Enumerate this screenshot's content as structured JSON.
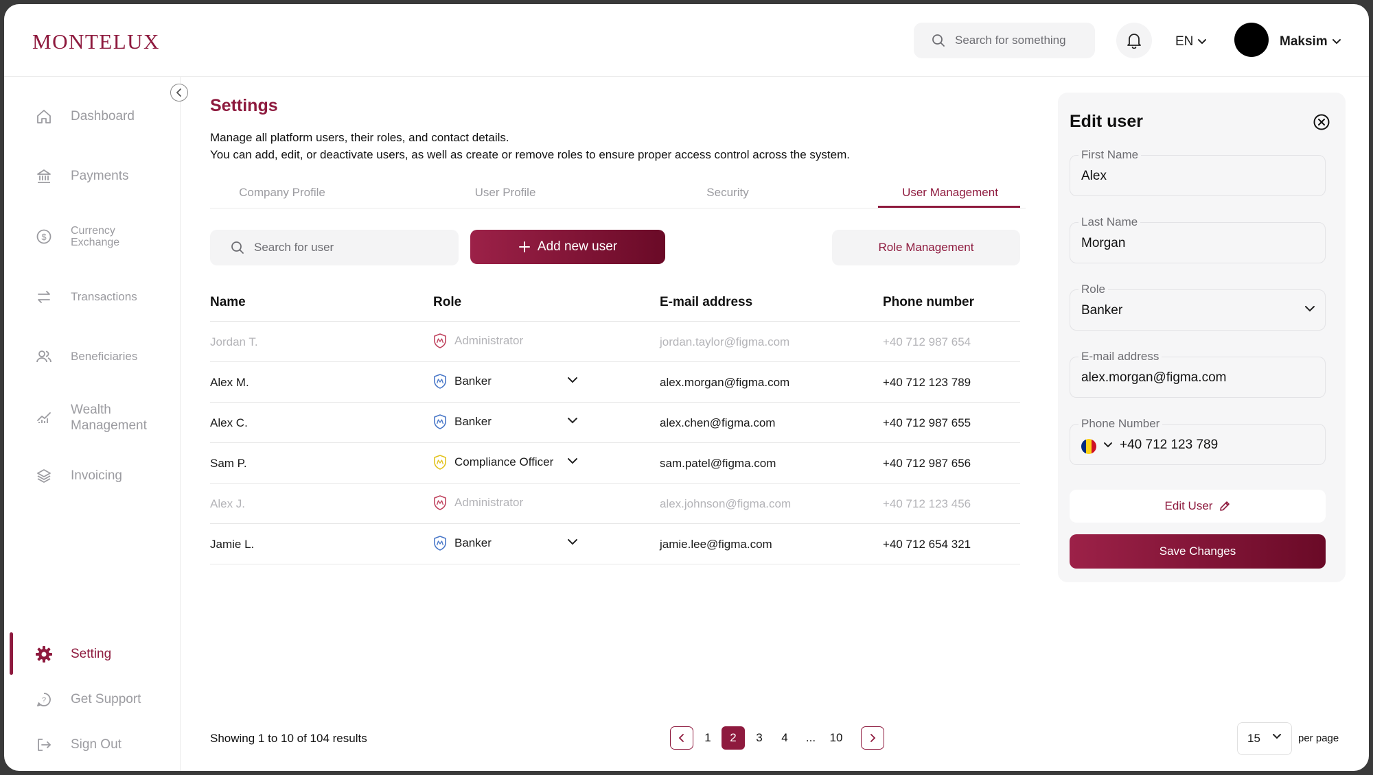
{
  "brand": {
    "logo": "MONTELUX",
    "accent": "#8e1a3e"
  },
  "topbar": {
    "search_placeholder": "Search for something",
    "language": "EN",
    "user_name": "Maksim"
  },
  "sidebar": {
    "items": [
      {
        "label": "Dashboard",
        "icon": "home-icon"
      },
      {
        "label": "Payments",
        "icon": "bank-icon"
      },
      {
        "label": "Currency Exchange",
        "line1": "Currency",
        "line2": "Exchange",
        "icon": "dollar-circle-icon"
      },
      {
        "label": "Transactions",
        "icon": "arrows-swap-icon"
      },
      {
        "label": "Beneficiaries",
        "icon": "users-icon"
      },
      {
        "label": "Wealth Management",
        "line1": "Wealth",
        "line2": "Management",
        "icon": "chart-icon"
      },
      {
        "label": "Invoicing",
        "icon": "layers-icon"
      }
    ],
    "bottom": [
      {
        "label": "Setting",
        "icon": "gear-icon",
        "active": true
      },
      {
        "label": "Get Support",
        "icon": "support-icon"
      },
      {
        "label": "Sign Out",
        "icon": "sign-out-icon"
      }
    ]
  },
  "main": {
    "title": "Settings",
    "desc_line1": "Manage all platform users, their roles, and contact details.",
    "desc_line2": "You can add, edit, or deactivate users, as well as create or remove roles to ensure proper access control across the system.",
    "tabs": [
      "Company Profile",
      "User Profile",
      "Security",
      "User Management"
    ],
    "active_tab": "User Management",
    "user_search_placeholder": "Search for user",
    "add_button": "Add new user",
    "role_button": "Role Management",
    "table": {
      "headers": [
        "Name",
        "Role",
        "E-mail address",
        "Phone number"
      ],
      "rows": [
        {
          "name": "Jordan T.",
          "role": "Administrator",
          "email": "jordan.taylor@figma.com",
          "phone": "+40 712 987 654",
          "disabled": true,
          "shield": "#c0445f"
        },
        {
          "name": "Alex M.",
          "role": "Banker",
          "email": "alex.morgan@figma.com",
          "phone": "+40 712 123 789",
          "disabled": false,
          "shield": "#4a78c8"
        },
        {
          "name": "Alex C.",
          "role": "Banker",
          "email": "alex.chen@figma.com",
          "phone": "+40 712 987 655",
          "disabled": false,
          "shield": "#4a78c8"
        },
        {
          "name": "Sam P.",
          "role": "Compliance Officer",
          "email": "sam.patel@figma.com",
          "phone": "+40 712 987 656",
          "disabled": false,
          "shield": "#e2c21e"
        },
        {
          "name": "Alex J.",
          "role": "Administrator",
          "email": "alex.johnson@figma.com",
          "phone": "+40 712 123 456",
          "disabled": true,
          "shield": "#c0445f"
        },
        {
          "name": "Jamie L.",
          "role": "Banker",
          "email": "jamie.lee@figma.com",
          "phone": "+40 712 654 321",
          "disabled": false,
          "shield": "#4a78c8"
        }
      ]
    },
    "pagination": {
      "showing": "Showing 1 to 10 of 104 results",
      "pages": [
        "1",
        "2",
        "3",
        "4",
        "...",
        "10"
      ],
      "current": "2",
      "per_page_value": "15",
      "per_page_label": "per page"
    }
  },
  "edit_panel": {
    "title": "Edit user",
    "first_name_label": "First Name",
    "first_name": "Alex",
    "last_name_label": "Last Name",
    "last_name": "Morgan",
    "role_label": "Role",
    "role": "Banker",
    "email_label": "E-mail address",
    "email": "alex.morgan@figma.com",
    "phone_label": "Phone Number",
    "phone": "+40 712 123 789",
    "edit_button": "Edit User",
    "save_button": "Save Changes"
  }
}
